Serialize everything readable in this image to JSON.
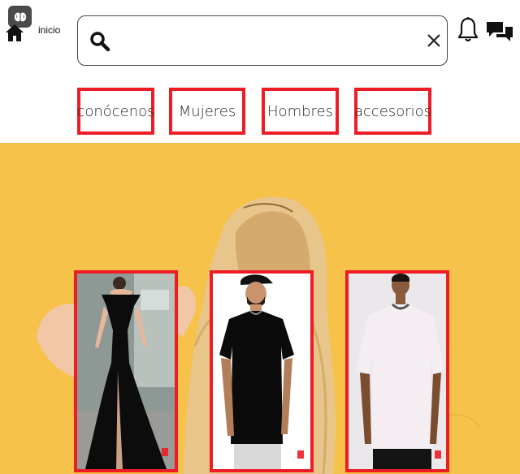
{
  "header": {
    "home_label": "inicio",
    "search": {
      "value": "",
      "placeholder": ""
    }
  },
  "nav": {
    "items": [
      {
        "label": "conócenos"
      },
      {
        "label": "Mujeres"
      },
      {
        "label": "Hombres"
      },
      {
        "label": "accesorios"
      }
    ]
  },
  "hero": {
    "background_color": "#f7c24a",
    "products": [
      {
        "name": "black-gown-product"
      },
      {
        "name": "black-tshirt-product"
      },
      {
        "name": "white-tshirt-product"
      }
    ]
  },
  "colors": {
    "accent_border": "#ee1c24"
  }
}
